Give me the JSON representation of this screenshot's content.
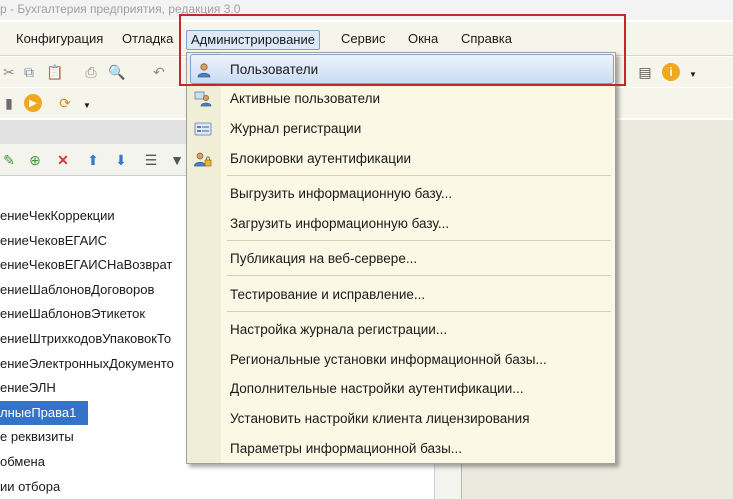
{
  "window": {
    "title": "р - Бухгалтерия предприятия, редакция 3.0"
  },
  "menubar": {
    "items": [
      {
        "label": "Конфигурация"
      },
      {
        "label": "Отладка"
      },
      {
        "label": "Администрирование",
        "active": true
      },
      {
        "label": "Сервис"
      },
      {
        "label": "Окна"
      },
      {
        "label": "Справка"
      }
    ]
  },
  "toolbar": {
    "icons": [
      "cut-icon",
      "copy-icon",
      "paste-icon",
      "print-icon",
      "preview-icon",
      "undo-icon",
      "run-icon",
      "debug-icon",
      "sheet-icon",
      "info-icon"
    ]
  },
  "admin_menu": {
    "items": [
      {
        "label": "Пользователи",
        "icon": "user-icon",
        "highlighted": true
      },
      {
        "label": "Активные пользователи",
        "icon": "active-users-icon"
      },
      {
        "label": "Журнал регистрации",
        "icon": "log-icon"
      },
      {
        "label": "Блокировки аутентификации",
        "icon": "lock-users-icon"
      },
      {
        "label": "Выгрузить информационную базу..."
      },
      {
        "label": "Загрузить информационную базу..."
      },
      {
        "label": "Публикация на веб-сервере..."
      },
      {
        "label": "Тестирование и исправление..."
      },
      {
        "label": "Настройка журнала регистрации..."
      },
      {
        "label": "Региональные установки информационной базы..."
      },
      {
        "label": "Дополнительные настройки аутентификации..."
      },
      {
        "label": "Установить настройки клиента лицензирования"
      },
      {
        "label": "Параметры информационной базы..."
      }
    ]
  },
  "tree": {
    "rows": [
      {
        "label": "ениеЧекКоррекции"
      },
      {
        "label": "ениеЧековЕГАИС"
      },
      {
        "label": "ениеЧековЕГАИСНаВозврат"
      },
      {
        "label": "ениеШаблоновДоговоров"
      },
      {
        "label": "ениеШаблоновЭтикеток"
      },
      {
        "label": "ениеШтрихкодовУпаковокТо"
      },
      {
        "label": "ениеЭлектронныхДокументо"
      },
      {
        "label": "ениеЭЛН"
      },
      {
        "label": "лныеПрава1",
        "selected": true
      },
      {
        "label": "е реквизиты"
      },
      {
        "label": "обмена"
      },
      {
        "label": "ии отбора"
      }
    ]
  },
  "colors": {
    "highlight_border": "#c4262e",
    "selection": "#3573c9",
    "menu_background": "#fbf8e6"
  }
}
